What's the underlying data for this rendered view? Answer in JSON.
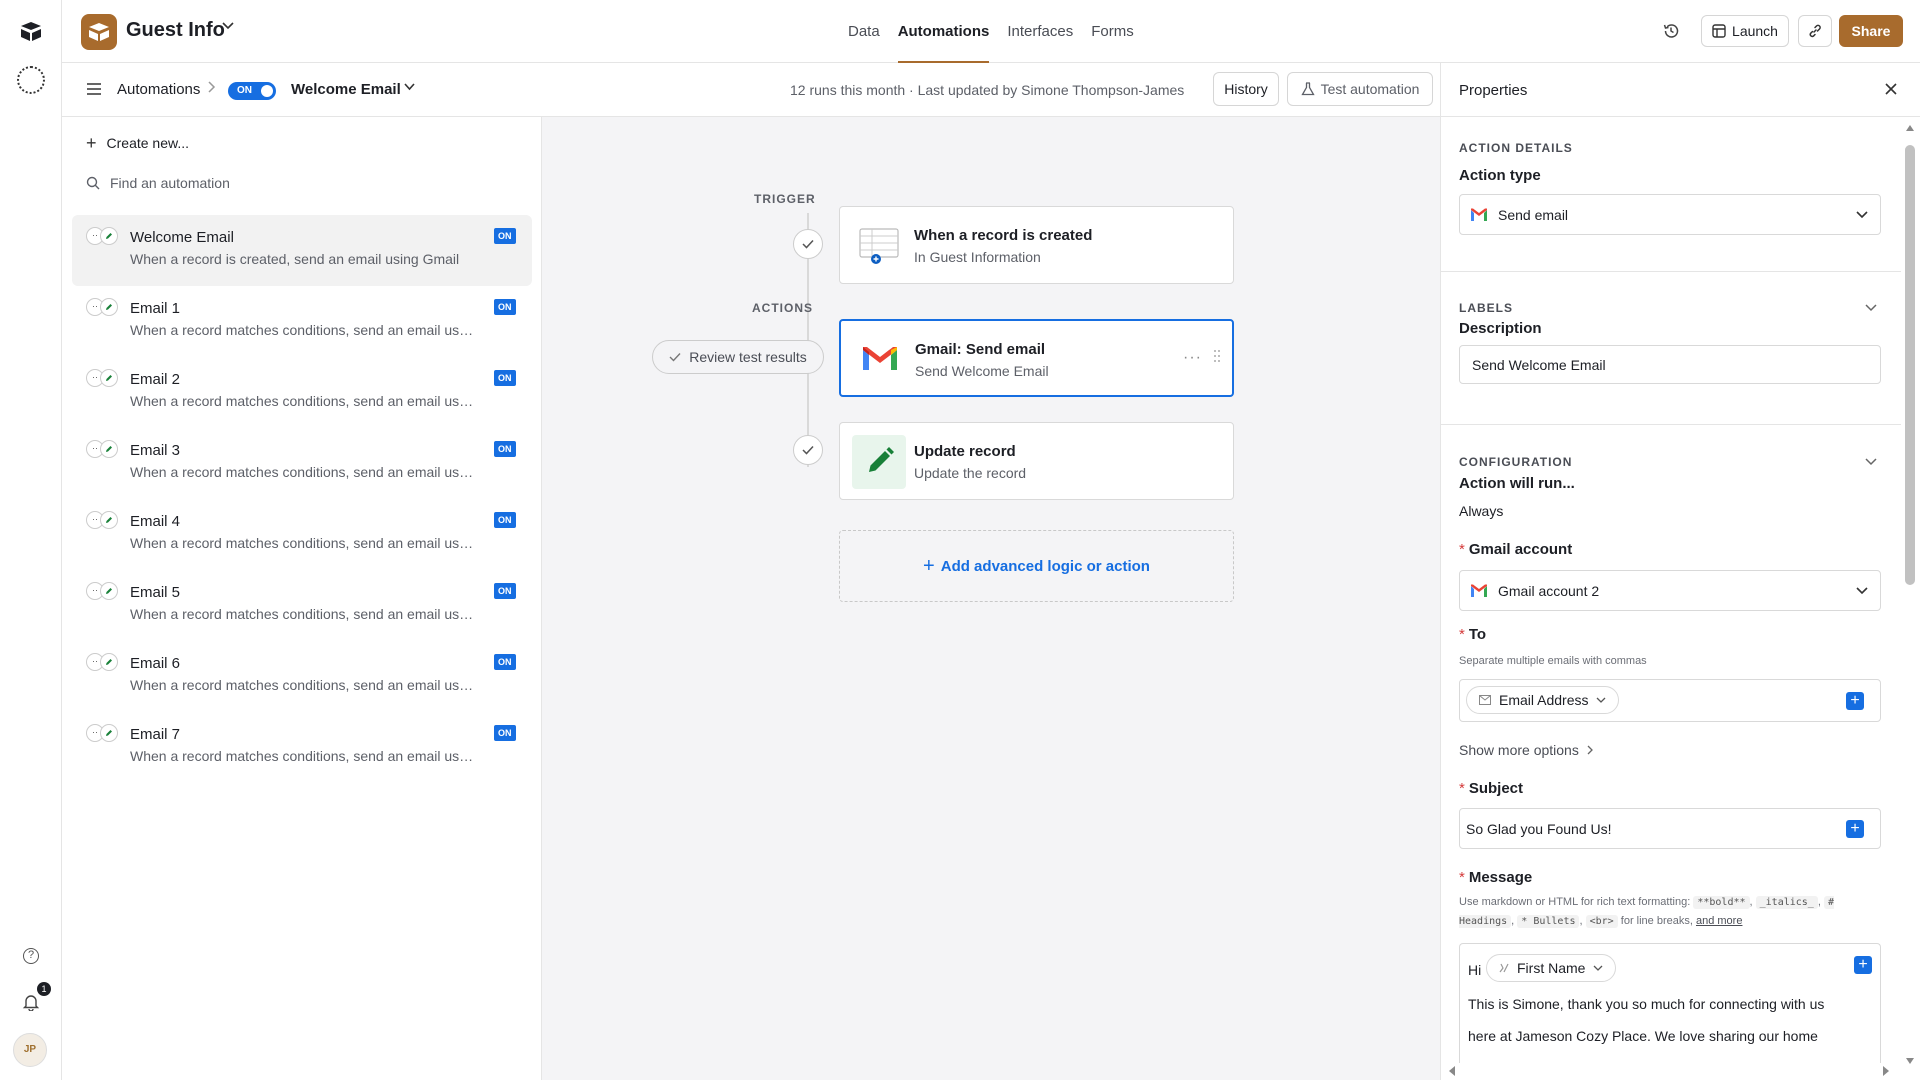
{
  "app": {
    "base_name": "Guest Info",
    "top_tabs": [
      {
        "label": "Data",
        "active": false
      },
      {
        "label": "Automations",
        "active": true
      },
      {
        "label": "Interfaces",
        "active": false
      },
      {
        "label": "Forms",
        "active": false
      }
    ],
    "launch_label": "Launch",
    "share_label": "Share",
    "notification_count": "1",
    "brand_color": "#a86b2d",
    "accent_color": "#166ee1"
  },
  "subheader": {
    "breadcrumb_root": "Automations",
    "toggle_label": "ON",
    "automation_name": "Welcome Email",
    "runs_text": "12 runs this month · Last updated by Simone Thompson-James",
    "history_label": "History",
    "test_label": "Test automation"
  },
  "sidebar": {
    "create_new": "Create new...",
    "search_placeholder": "Find an automation",
    "items": [
      {
        "name": "Welcome Email",
        "desc": "When a record is created, send an email using Gmail",
        "status": "ON",
        "selected": true
      },
      {
        "name": "Email 1",
        "desc": "When a record matches conditions, send an email using Gmail",
        "status": "ON"
      },
      {
        "name": "Email 2",
        "desc": "When a record matches conditions, send an email using Gmail",
        "status": "ON"
      },
      {
        "name": "Email 3",
        "desc": "When a record matches conditions, send an email using Gmail",
        "status": "ON"
      },
      {
        "name": "Email 4",
        "desc": "When a record matches conditions, send an email using Gmail",
        "status": "ON"
      },
      {
        "name": "Email 5",
        "desc": "When a record matches conditions, send an email using Gmail",
        "status": "ON"
      },
      {
        "name": "Email 6",
        "desc": "When a record matches conditions, send an email using Gmail",
        "status": "ON"
      },
      {
        "name": "Email 7",
        "desc": "When a record matches conditions, send an email using Gmail",
        "status": "ON"
      }
    ]
  },
  "canvas": {
    "trigger_label": "TRIGGER",
    "actions_label": "ACTIONS",
    "trigger": {
      "title": "When a record is created",
      "subtitle": "In Guest Information"
    },
    "action1": {
      "title": "Gmail: Send email",
      "subtitle": "Send Welcome Email"
    },
    "action2": {
      "title": "Update record",
      "subtitle": "Update the record"
    },
    "review_label": "Review test results",
    "add_label": "Add advanced logic or action"
  },
  "properties": {
    "title": "Properties",
    "action_details": "ACTION DETAILS",
    "action_type_label": "Action type",
    "action_type_value": "Send email",
    "labels_section": "LABELS",
    "description_label": "Description",
    "description_value": "Send Welcome Email",
    "configuration_section": "CONFIGURATION",
    "run_label": "Action will run...",
    "run_value": "Always",
    "gmail_account_label": "Gmail account",
    "gmail_account_value": "Gmail account 2",
    "to_label": "To",
    "to_hint": "Separate multiple emails with commas",
    "to_chip": "Email Address",
    "show_more": "Show more options",
    "subject_label": "Subject",
    "subject_value": "So Glad you Found Us!",
    "message_label": "Message",
    "message_hint_prefix": "Use markdown or HTML for rich text formatting:",
    "message_hint_bold": "**bold**",
    "message_hint_italics": "_italics_",
    "message_hint_headings": "# Headings",
    "message_hint_bullets": "* Bullets",
    "message_hint_br": "<br>",
    "message_hint_br_suffix": "for line breaks,",
    "message_hint_more": "and more",
    "message_hi": "Hi",
    "message_chip": "First Name",
    "message_line1": "This is Simone, thank you so much for connecting with us",
    "message_line2": "here at Jameson Cozy Place. We love sharing our home"
  }
}
